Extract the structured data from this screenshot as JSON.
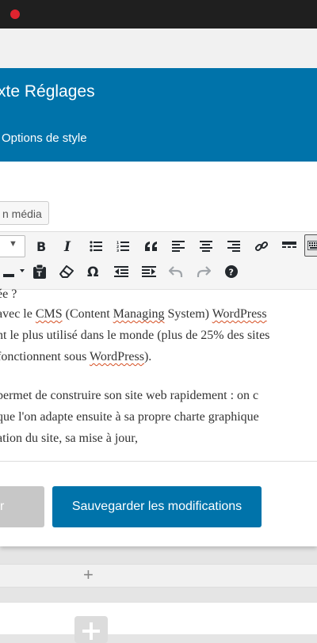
{
  "modal": {
    "title": "xte Réglages",
    "subtitle": "Options de style"
  },
  "editor": {
    "media_button": "n média",
    "toolbar_row1": [
      "format-select-caret-icon",
      "bold-icon",
      "italic-icon",
      "bullet-list-icon",
      "numbered-list-icon",
      "blockquote-icon",
      "align-left-icon",
      "align-center-icon",
      "align-right-icon",
      "link-icon",
      "read-more-icon",
      "toolbar-toggle-icon"
    ],
    "toolbar_row2": [
      "text-color-icon",
      "paste-as-text-icon",
      "clear-formatting-icon",
      "special-character-icon",
      "outdent-icon",
      "indent-icon",
      "undo-icon",
      "redo-icon",
      "help-icon"
    ],
    "content": {
      "p1_l0": "ée ?",
      "p1_l1_a": "avec le ",
      "p1_l1_cms": "CMS",
      "p1_l1_b": " (Content ",
      "p1_l1_managing": "Managing",
      "p1_l1_c": " System) ",
      "p1_l1_wp": "WordPress",
      "p1_l2": "nt le plus utilisé dans le monde (plus de 25% des sites",
      "p1_l3_a": "fonctionnent sous ",
      "p1_l3_wp": "WordPress",
      "p1_l3_b": ").",
      "p2_l1": "permet de construire son site web rapidement : on c",
      "p2_l2": "que l'on adapte ensuite à sa propre charte graphique",
      "p2_l3": "ation du site, sa mise à jour,"
    }
  },
  "actions": {
    "secondary_label": "r",
    "save_label": "Sauvegarder les modifications"
  },
  "builder": {
    "add_row_symbol": "+"
  },
  "colors": {
    "accent": "#0073aa",
    "topbar": "#1f1f1f",
    "record_dot": "#e0242f"
  }
}
